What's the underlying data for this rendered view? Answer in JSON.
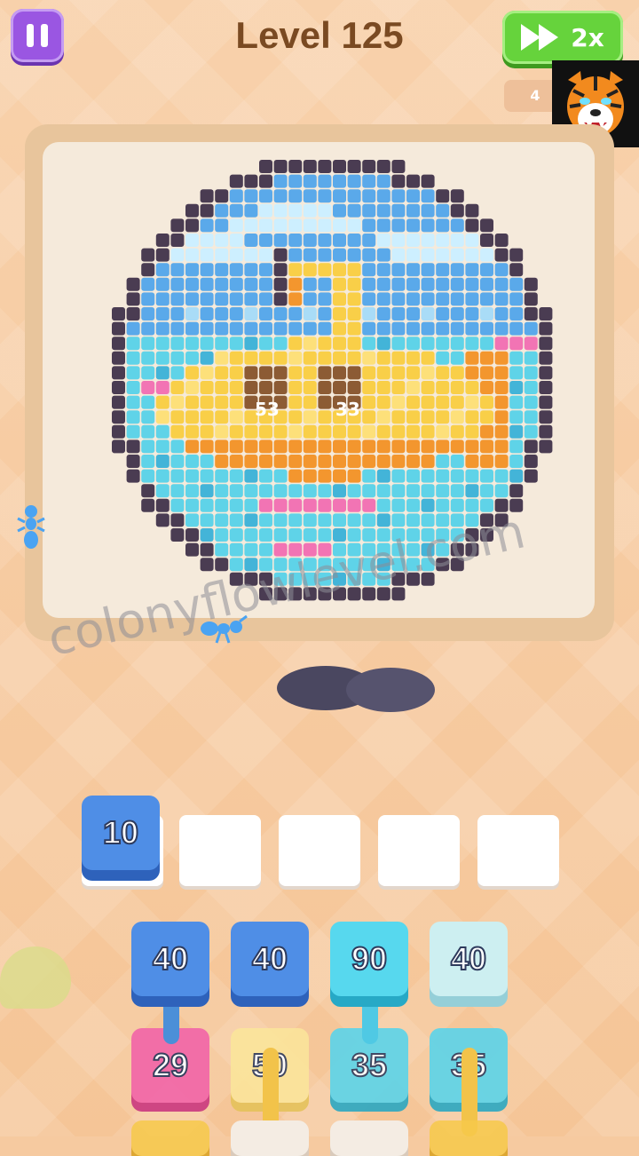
{
  "header": {
    "level_title": "Level 125",
    "speed_label": "2x",
    "counter_text": "4"
  },
  "board": {
    "labels": [
      {
        "text": "53"
      },
      {
        "text": "33"
      }
    ],
    "watermark": "colonyflowlevel.com"
  },
  "slots": {
    "filled": [
      {
        "value": "10",
        "color": "blue"
      }
    ],
    "empty_count": 4
  },
  "columns": [
    {
      "front": {
        "value": "40",
        "color": "blue"
      },
      "back": {
        "value": "29",
        "color": "pink"
      }
    },
    {
      "front": {
        "value": "40",
        "color": "blue"
      },
      "back": {
        "value": "50",
        "color": "yellow"
      }
    },
    {
      "front": {
        "value": "90",
        "color": "cyan"
      },
      "back": {
        "value": "35",
        "color": "teal"
      }
    },
    {
      "front": {
        "value": "40",
        "color": "pale"
      },
      "back": {
        "value": "35",
        "color": "teal"
      }
    }
  ],
  "colors": {
    "dark": "#4a3c52",
    "sky": "#5aa9ea",
    "cloud": "#cdefff",
    "cloud2": "#a9dcf7",
    "water": "#5fd3e8",
    "water_dark": "#43b4d8",
    "pink": "#f274b4",
    "yellow": "#f9cf48",
    "yellow_light": "#fde07a",
    "orange": "#f3962e",
    "brown": "#8c5b34"
  }
}
